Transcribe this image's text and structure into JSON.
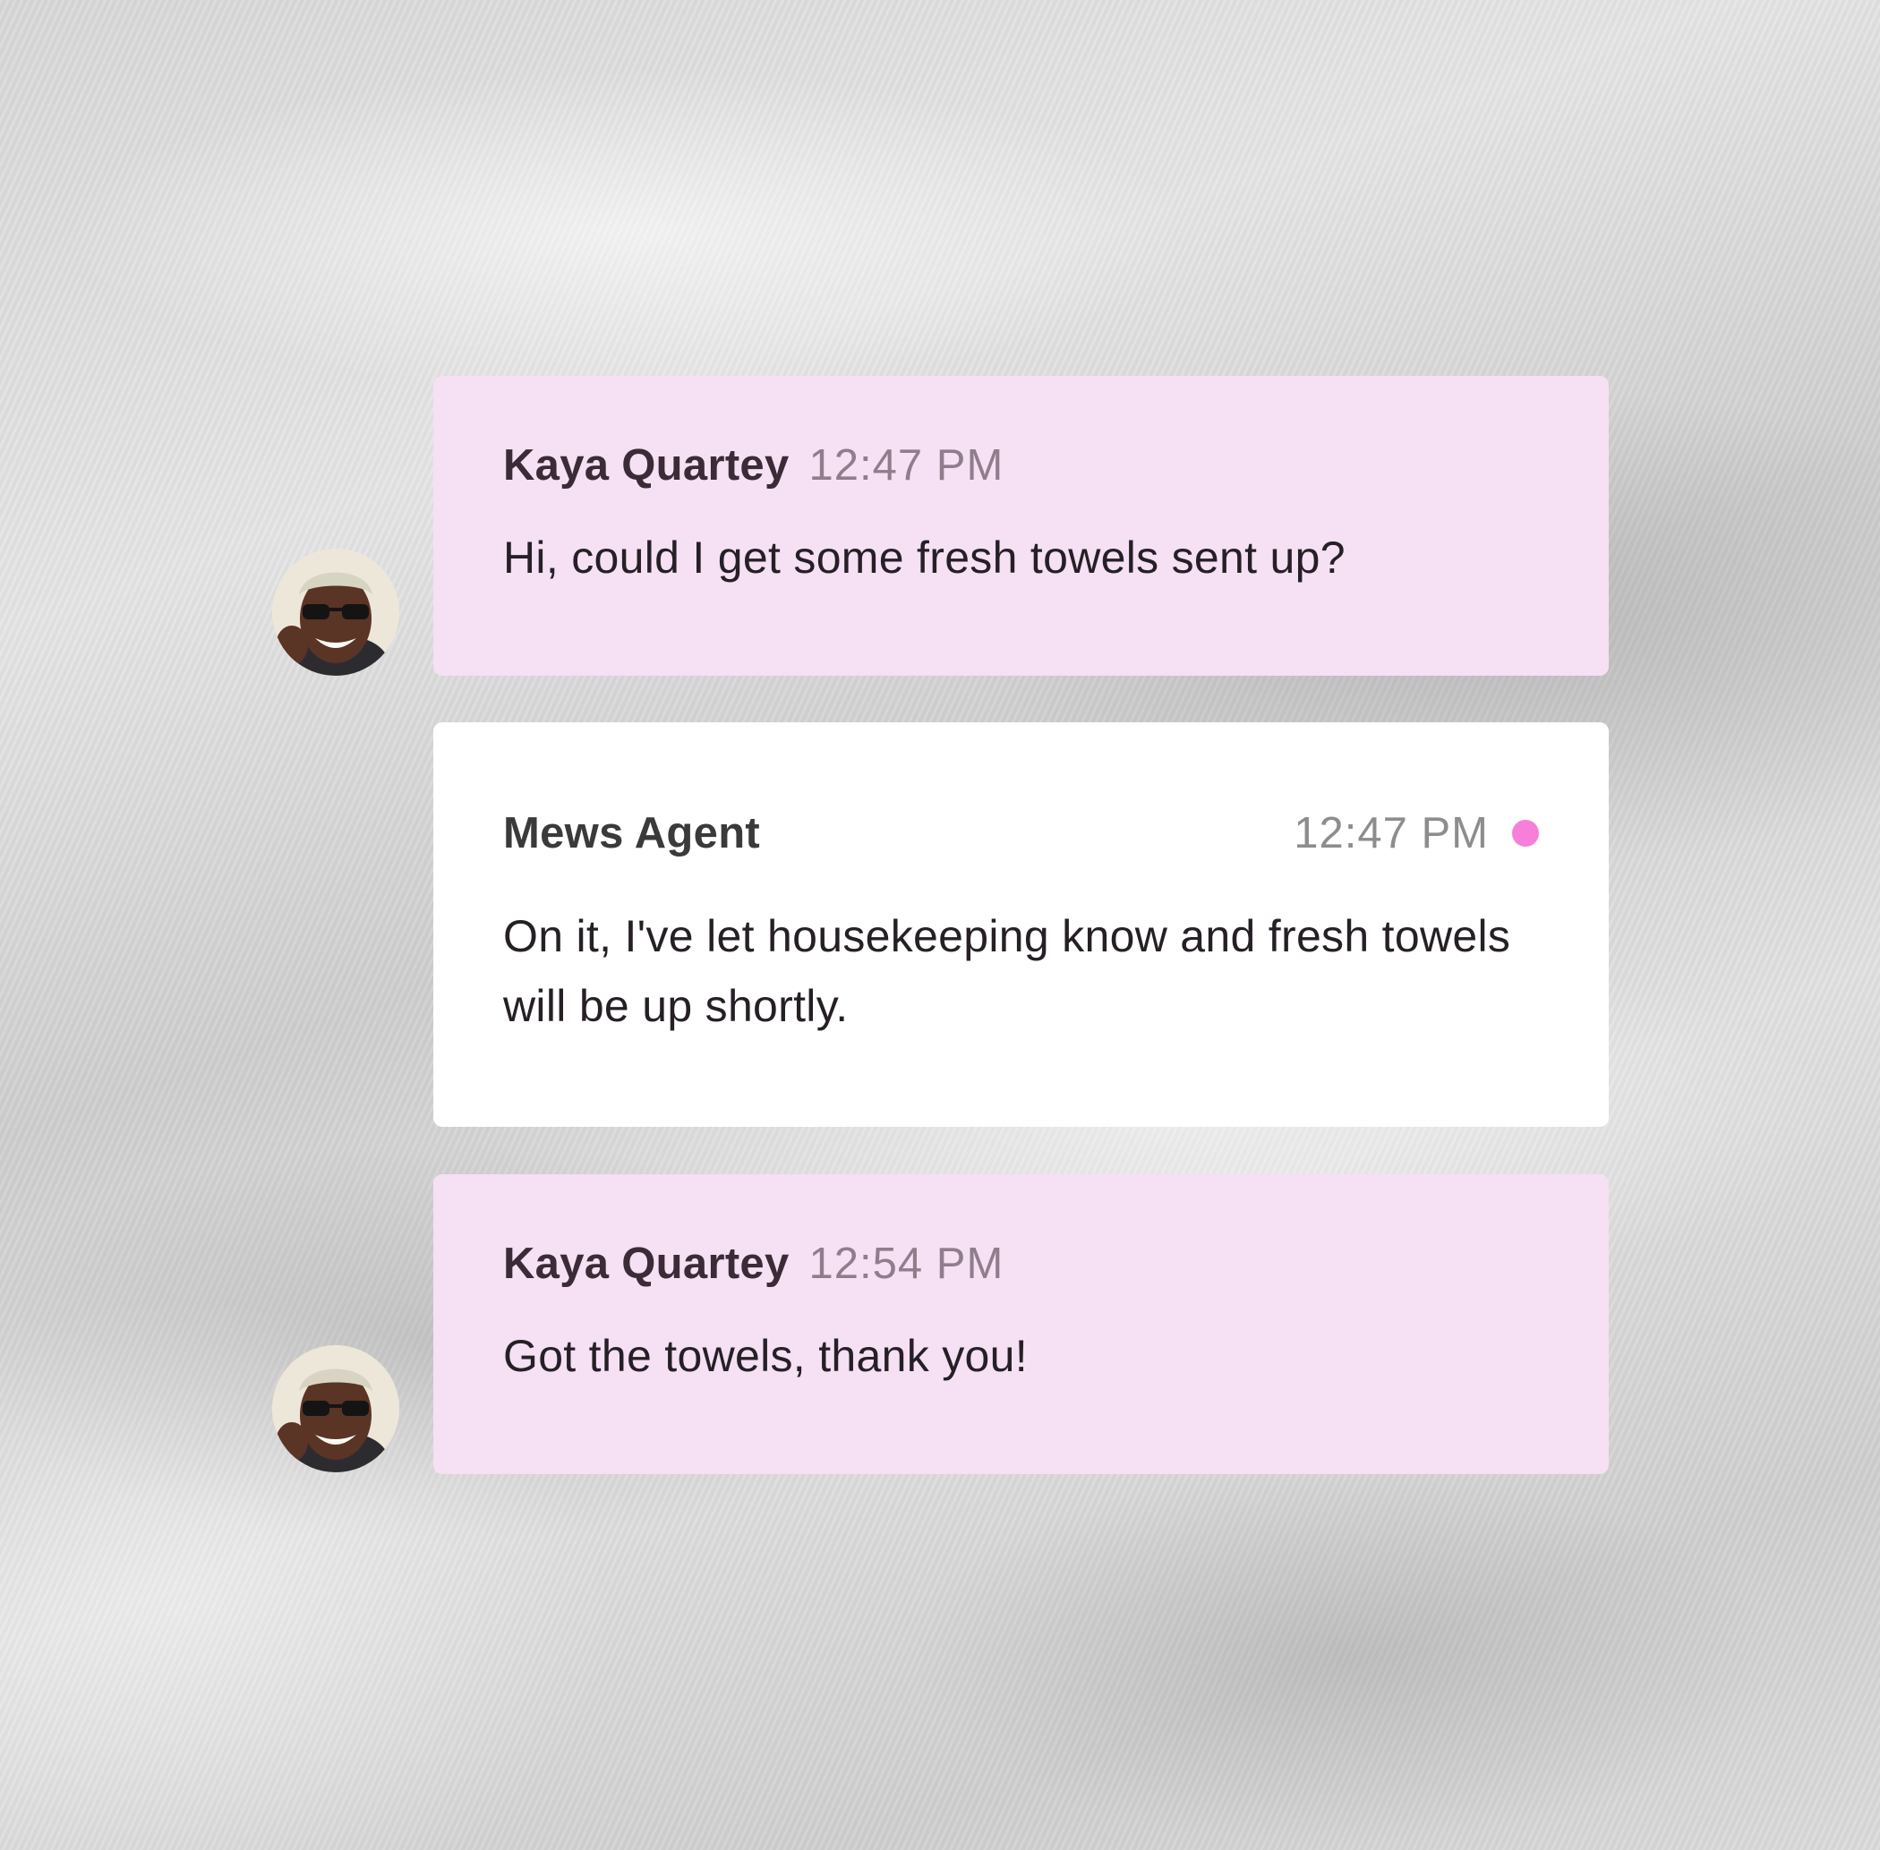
{
  "messages": [
    {
      "sender": "Kaya Quartey",
      "time": "12:47 PM",
      "text": "Hi, could I get some fresh towels sent up?"
    },
    {
      "sender": "Mews Agent",
      "time": "12:47 PM",
      "text": "On it, I've let housekeeping know and fresh towels will be up shortly."
    },
    {
      "sender": "Kaya Quartey",
      "time": "12:54 PM",
      "text": "Got the towels, thank you!"
    }
  ],
  "colors": {
    "guest_bubble": "#f5e0f4",
    "agent_bubble": "#ffffff",
    "unread_dot": "#f77fda"
  },
  "icons": {
    "guest_avatar": "guest-avatar-photo",
    "status_dot": "unread-dot-icon"
  }
}
